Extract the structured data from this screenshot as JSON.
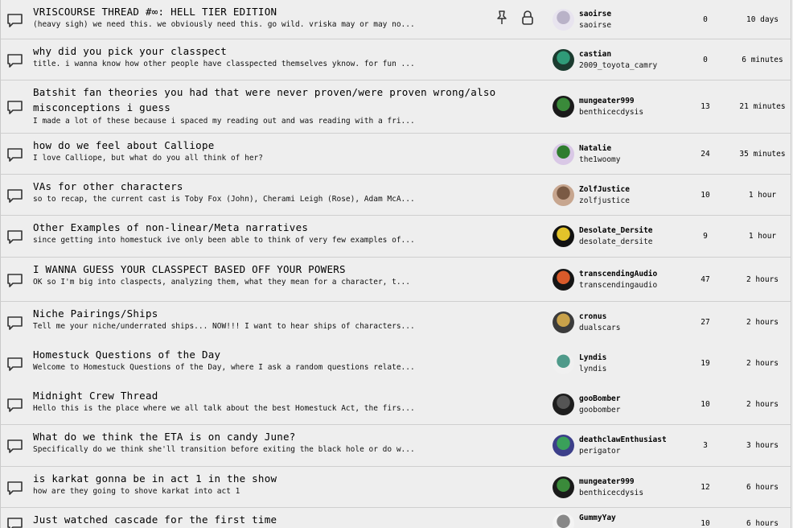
{
  "threads": [
    {
      "title": "VRISCOURSE THREAD #∞: HELL TIER EDITION",
      "excerpt": "(heavy sigh) we need this. we obviously need this. go wild. vriska may or may no...",
      "display_name": "saoirse",
      "username": "saoirse",
      "replies": "0",
      "updated": "10 days",
      "pinned": true,
      "locked": true,
      "avatar_colors": [
        "#e8e4ef",
        "#b9b2c8"
      ]
    },
    {
      "title": "why did you pick your classpect",
      "excerpt": "title. i wanna know how other people have classpected themselves yknow. for fun ...",
      "display_name": "castian",
      "username": "2009_toyota_camry",
      "replies": "0",
      "updated": "6 minutes",
      "avatar_colors": [
        "#1b3b2f",
        "#2f9b78"
      ]
    },
    {
      "title": "Batshit fan theories you had that were never proven/were proven wrong/also misconceptions i guess",
      "excerpt": "I made a lot of these because i spaced my reading out and was reading with a fri...",
      "display_name": "mungeater999",
      "username": "benthicecdysis",
      "replies": "13",
      "updated": "21 minutes",
      "avatar_colors": [
        "#1a1a1a",
        "#3a8a3a"
      ]
    },
    {
      "title": "how do we feel about Calliope",
      "excerpt": "I love Calliope, but what do you all think of her?",
      "display_name": "Natalie",
      "username": "the1woomy",
      "replies": "24",
      "updated": "35 minutes",
      "avatar_colors": [
        "#d9c8e6",
        "#2f7d2f"
      ]
    },
    {
      "title": "VAs for other characters",
      "excerpt": "so to recap, the current cast is Toby Fox (John), Cherami Leigh (Rose), Adam McA...",
      "display_name": "ZolfJustice",
      "username": "zolfjustice",
      "replies": "10",
      "updated": "1 hour",
      "avatar_colors": [
        "#c7a68f",
        "#7a5a44"
      ]
    },
    {
      "title": "Other Examples of non-linear/Meta narratives",
      "excerpt": "since getting into homestuck ive only been able to think of very few examples of...",
      "display_name": "Desolate_Dersite",
      "username": "desolate_dersite",
      "replies": "9",
      "updated": "1 hour",
      "avatar_colors": [
        "#111111",
        "#e2c32a"
      ]
    },
    {
      "title": "I WANNA GUESS YOUR CLASSPECT BASED OFF YOUR POWERS",
      "excerpt": "OK so I'm big into claspects, analyzing them, what they mean for a character, t...",
      "display_name": "transcendingAudio",
      "username": "transcendingaudio",
      "replies": "47",
      "updated": "2 hours",
      "avatar_colors": [
        "#151515",
        "#d85a2a"
      ]
    },
    {
      "title": "Niche Pairings/Ships",
      "excerpt": "Tell me your niche/underrated ships... NOW!!! I want to hear ships of characters...",
      "display_name": "cronus",
      "username": "dualscars",
      "replies": "27",
      "updated": "2 hours",
      "avatar_colors": [
        "#3b3b3b",
        "#c9a24a"
      ]
    },
    {
      "title": "Homestuck Questions of the Day",
      "excerpt": "Welcome to Homestuck Questions of the Day, where I ask a random questions relate...",
      "display_name": "Lyndis",
      "username": "lyndis",
      "replies": "19",
      "updated": "2 hours",
      "avatar_colors": [
        "#f0f0f0",
        "#4f9a8a"
      ]
    },
    {
      "title": "Midnight Crew Thread",
      "excerpt": "Hello this is the place where we all talk about the best Homestuck Act, the firs...",
      "display_name": "gooBomber",
      "username": "goobomber",
      "replies": "10",
      "updated": "2 hours",
      "avatar_colors": [
        "#1e1e1e",
        "#555555"
      ]
    },
    {
      "title": "What do we think the ETA is on candy June?",
      "excerpt": "Specifically do we think she'll transition before exiting the black hole or do w...",
      "display_name": "deathclawEnthusiast",
      "username": "perigator",
      "replies": "3",
      "updated": "3 hours",
      "avatar_colors": [
        "#3c3f8a",
        "#3aa05a"
      ]
    },
    {
      "title": "is karkat gonna be in act 1 in the show",
      "excerpt": "how are they going to shove karkat into act 1",
      "display_name": "mungeater999",
      "username": "benthicecdysis",
      "replies": "12",
      "updated": "6 hours",
      "avatar_colors": [
        "#1a1a1a",
        "#3a8a3a"
      ]
    },
    {
      "title": "Just watched cascade for the first time",
      "excerpt": "",
      "display_name": "GummyYay",
      "username": "",
      "replies": "10",
      "updated": "6 hours",
      "avatar_colors": [
        "#f4f4f4",
        "#888888"
      ]
    }
  ]
}
